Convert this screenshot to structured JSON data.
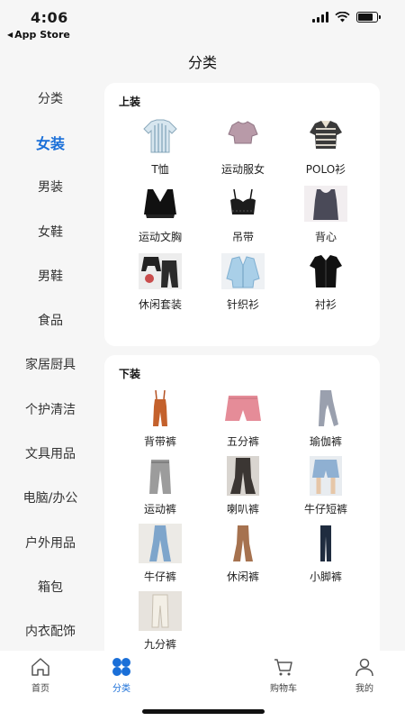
{
  "status": {
    "time": "4:06",
    "back_app": "App Store"
  },
  "nav": {
    "title": "分类"
  },
  "sidebar": {
    "items": [
      {
        "label": "分类",
        "active": false
      },
      {
        "label": "女装",
        "active": true
      },
      {
        "label": "男装",
        "active": false
      },
      {
        "label": "女鞋",
        "active": false
      },
      {
        "label": "男鞋",
        "active": false
      },
      {
        "label": "食品",
        "active": false
      },
      {
        "label": "家居厨具",
        "active": false
      },
      {
        "label": "个护清洁",
        "active": false
      },
      {
        "label": "文具用品",
        "active": false
      },
      {
        "label": "电脑/办公",
        "active": false
      },
      {
        "label": "户外用品",
        "active": false
      },
      {
        "label": "箱包",
        "active": false
      },
      {
        "label": "内衣配饰",
        "active": false
      }
    ]
  },
  "sections": {
    "tops": {
      "title": "上装",
      "items": [
        {
          "label": "T恤",
          "icon": "shirt-striped-icon"
        },
        {
          "label": "运动服女",
          "icon": "crop-top-icon"
        },
        {
          "label": "POLO衫",
          "icon": "polo-shirt-icon"
        },
        {
          "label": "运动文胸",
          "icon": "sports-bra-icon"
        },
        {
          "label": "吊带",
          "icon": "camisole-icon"
        },
        {
          "label": "背心",
          "icon": "tank-top-icon"
        },
        {
          "label": "休闲套装",
          "icon": "casual-set-icon"
        },
        {
          "label": "针织衫",
          "icon": "cardigan-icon"
        },
        {
          "label": "衬衫",
          "icon": "black-shirt-icon"
        }
      ]
    },
    "bottoms": {
      "title": "下装",
      "items": [
        {
          "label": "背带裤",
          "icon": "overalls-icon"
        },
        {
          "label": "五分裤",
          "icon": "shorts-pink-icon"
        },
        {
          "label": "瑜伽裤",
          "icon": "yoga-pants-icon"
        },
        {
          "label": "运动裤",
          "icon": "sweatpants-icon"
        },
        {
          "label": "喇叭裤",
          "icon": "flare-pants-icon"
        },
        {
          "label": "牛仔短裤",
          "icon": "denim-shorts-icon"
        },
        {
          "label": "牛仔裤",
          "icon": "jeans-icon"
        },
        {
          "label": "休闲裤",
          "icon": "casual-pants-icon"
        },
        {
          "label": "小脚裤",
          "icon": "skinny-pants-icon"
        },
        {
          "label": "九分裤",
          "icon": "cropped-pants-icon"
        }
      ]
    }
  },
  "tabbar": {
    "items": [
      {
        "label": "首页",
        "icon": "home-icon",
        "active": false
      },
      {
        "label": "分类",
        "icon": "category-icon",
        "active": true
      },
      {
        "label": "",
        "icon": "",
        "active": false
      },
      {
        "label": "购物车",
        "icon": "cart-icon",
        "active": false
      },
      {
        "label": "我的",
        "icon": "user-icon",
        "active": false
      }
    ]
  },
  "colors": {
    "accent": "#1a6fd8",
    "background": "#f6f6f6",
    "card": "#ffffff"
  }
}
